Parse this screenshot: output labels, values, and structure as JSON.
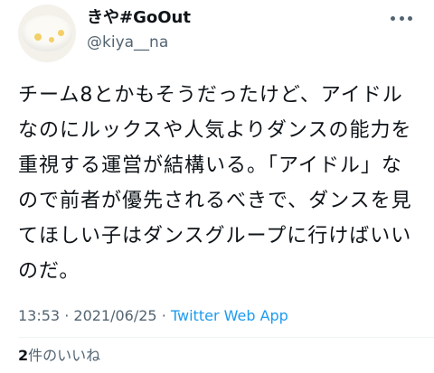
{
  "user": {
    "display_name": "きや#GoOut",
    "handle": "@kiya__na"
  },
  "tweet": {
    "text": "チーム8とかもそうだったけど、アイドルなのにルックスや人気よりダンスの能力を重視する運営が結構いる。「アイドル」なので前者が優先されるべきで、ダンスを見てほしい子はダンスグループに行けばいいのだ。",
    "time": "13:53",
    "date": "2021/06/25",
    "separator": "·",
    "source": "Twitter Web App"
  },
  "stats": {
    "likes_count": "2",
    "likes_label": "件のいいね"
  },
  "colors": {
    "accent": "#1d9bf0",
    "secondary_text": "#536471"
  }
}
